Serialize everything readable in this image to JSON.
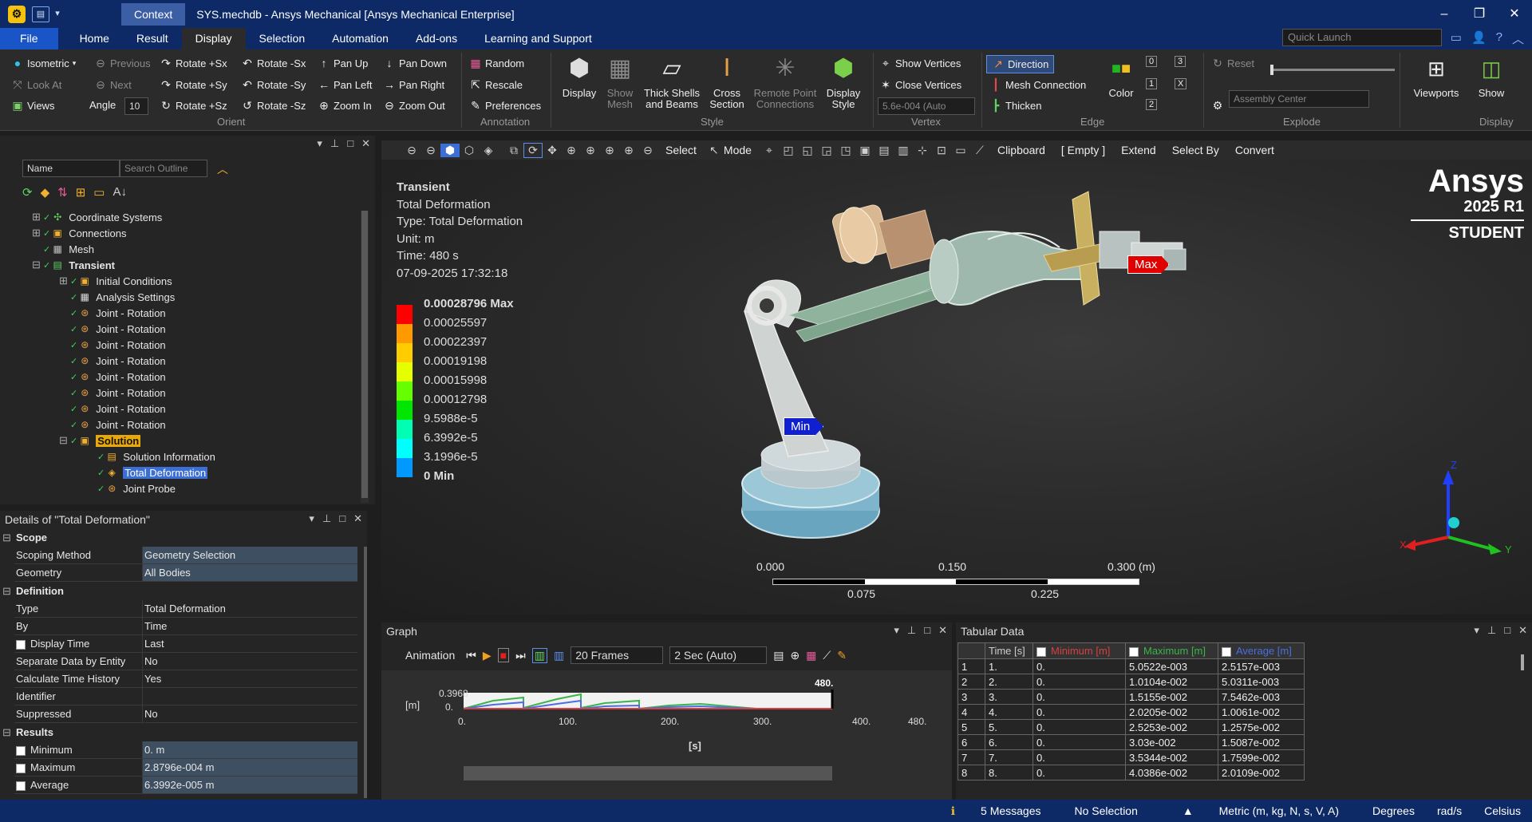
{
  "window": {
    "context_tab": "Context",
    "title": "SYS.mechdb - Ansys Mechanical [Ansys Mechanical Enterprise]"
  },
  "menu": {
    "tabs": [
      "File",
      "Home",
      "Result",
      "Display",
      "Selection",
      "Automation",
      "Add-ons",
      "Learning and Support"
    ],
    "active": "Display",
    "quick_launch": "Quick Launch"
  },
  "ribbon": {
    "orient": {
      "isometric": "Isometric",
      "previous": "Previous",
      "look_at": "Look At",
      "next": "Next",
      "views": "Views",
      "angle_label": "Angle",
      "angle_value": "10",
      "rotate_px": "Rotate +Sx",
      "rotate_mx": "Rotate -Sx",
      "rotate_py": "Rotate +Sy",
      "rotate_my": "Rotate -Sy",
      "rotate_pz": "Rotate +Sz",
      "rotate_mz": "Rotate -Sz",
      "pan_up": "Pan Up",
      "pan_down": "Pan Down",
      "pan_left": "Pan Left",
      "pan_right": "Pan Right",
      "zoom_in": "Zoom In",
      "zoom_out": "Zoom Out",
      "group": "Orient"
    },
    "annotation": {
      "random": "Random",
      "rescale": "Rescale",
      "preferences": "Preferences",
      "group": "Annotation"
    },
    "style": {
      "display": "Display",
      "show_mesh": "Show\nMesh",
      "thick_shells": "Thick Shells\nand Beams",
      "cross_section": "Cross\nSection",
      "remote_point": "Remote Point\nConnections",
      "display_style": "Display\nStyle",
      "group": "Style"
    },
    "vertex": {
      "show_vertices": "Show Vertices",
      "close_vertices": "Close Vertices",
      "value": "5.6e-004 (Auto",
      "group": "Vertex"
    },
    "edge": {
      "direction": "Direction",
      "mesh_connection": "Mesh Connection",
      "thicken": "Thicken",
      "color": "Color",
      "group": "Edge",
      "nums": [
        "0",
        "3",
        "1",
        "X",
        "2"
      ]
    },
    "explode": {
      "reset": "Reset",
      "assembly_center": "Assembly Center",
      "group": "Explode"
    },
    "display": {
      "viewports": "Viewports",
      "show": "Show",
      "group": "Display"
    }
  },
  "outline": {
    "filter_label": "Name",
    "search_placeholder": "Search Outline",
    "items": [
      {
        "label": "Coordinate Systems",
        "icon": "coordinate-icon"
      },
      {
        "label": "Connections",
        "icon": "connections-icon"
      },
      {
        "label": "Mesh",
        "icon": "mesh-icon"
      },
      {
        "label": "Transient",
        "icon": "transient-icon"
      },
      {
        "label": "Initial Conditions",
        "icon": "initial-conditions-icon"
      },
      {
        "label": "Analysis Settings",
        "icon": "analysis-settings-icon"
      },
      {
        "label": "Joint - Rotation",
        "icon": "joint-icon"
      },
      {
        "label": "Joint - Rotation",
        "icon": "joint-icon"
      },
      {
        "label": "Joint - Rotation",
        "icon": "joint-icon"
      },
      {
        "label": "Joint - Rotation",
        "icon": "joint-icon"
      },
      {
        "label": "Joint - Rotation",
        "icon": "joint-icon"
      },
      {
        "label": "Joint - Rotation",
        "icon": "joint-icon"
      },
      {
        "label": "Joint - Rotation",
        "icon": "joint-icon"
      },
      {
        "label": "Joint - Rotation",
        "icon": "joint-icon"
      },
      {
        "label": "Solution",
        "icon": "solution-icon"
      },
      {
        "label": "Solution Information",
        "icon": "solution-info-icon"
      },
      {
        "label": "Total Deformation",
        "icon": "deformation-icon"
      },
      {
        "label": "Joint Probe",
        "icon": "probe-icon"
      }
    ]
  },
  "details": {
    "title": "Details of \"Total Deformation\"",
    "scope": {
      "header": "Scope",
      "method_k": "Scoping Method",
      "method_v": "Geometry Selection",
      "geom_k": "Geometry",
      "geom_v": "All Bodies"
    },
    "definition": {
      "header": "Definition",
      "type_k": "Type",
      "type_v": "Total Deformation",
      "by_k": "By",
      "by_v": "Time",
      "dtime_k": "Display Time",
      "dtime_v": "Last",
      "sep_k": "Separate Data by Entity",
      "sep_v": "No",
      "calc_k": "Calculate Time History",
      "calc_v": "Yes",
      "id_k": "Identifier",
      "id_v": "",
      "sup_k": "Suppressed",
      "sup_v": "No"
    },
    "results": {
      "header": "Results",
      "min_k": "Minimum",
      "min_v": "0. m",
      "max_k": "Maximum",
      "max_v": "2.8796e-004 m",
      "avg_k": "Average",
      "avg_v": "6.3992e-005 m"
    }
  },
  "viewport": {
    "toolbar": {
      "select": "Select",
      "mode": "Mode",
      "clipboard": "Clipboard",
      "empty": "[ Empty ]",
      "extend": "Extend",
      "select_by": "Select By",
      "convert": "Convert"
    },
    "info": [
      "Transient",
      "Total Deformation",
      "Type: Total Deformation",
      "Unit: m",
      "Time: 480 s",
      "07-09-2025 17:32:18"
    ],
    "legend": [
      {
        "label": "0.00028796 Max",
        "color": "#ff0000"
      },
      {
        "label": "0.00025597",
        "color": "#ff9900"
      },
      {
        "label": "0.00022397",
        "color": "#ffcc00"
      },
      {
        "label": "0.00019198",
        "color": "#e6ff00"
      },
      {
        "label": "0.00015998",
        "color": "#66ff00"
      },
      {
        "label": "0.00012798",
        "color": "#00e600"
      },
      {
        "label": "9.5988e-5",
        "color": "#00ffb3"
      },
      {
        "label": "6.3992e-5",
        "color": "#00ffff"
      },
      {
        "label": "3.1996e-5",
        "color": "#0099ff"
      },
      {
        "label": "0 Min",
        "color": "#0000ff"
      }
    ],
    "brand": {
      "name": "Ansys",
      "version": "2025 R1",
      "edition": "STUDENT"
    },
    "max_tag": "Max",
    "min_tag": "Min",
    "scale": {
      "t0": "0.000",
      "t1": "0.150",
      "t2": "0.300 (m)",
      "t3": "0.075",
      "t4": "0.225"
    },
    "triad": {
      "z": "Z",
      "y": "Y",
      "x": "X"
    }
  },
  "graph": {
    "title": "Graph",
    "animation": "Animation",
    "frames": "20 Frames",
    "speed": "2 Sec (Auto)",
    "chart": {
      "y_max_label": "0.3968",
      "y_min_label": "0.",
      "x_ticks": [
        "0.",
        "100.",
        "200.",
        "300.",
        "400.",
        "480."
      ],
      "current_time": "480.",
      "x_unit": "[s]"
    }
  },
  "tabular": {
    "title": "Tabular Data",
    "headers": [
      "Time [s]",
      "Minimum [m]",
      "Maximum [m]",
      "Average [m]"
    ],
    "header_colors": [
      "#cccccc",
      "#d64040",
      "#3cb44b",
      "#4a6fe0"
    ],
    "rows": [
      [
        "1",
        "1.",
        "0.",
        "5.0522e-003",
        "2.5157e-003"
      ],
      [
        "2",
        "2.",
        "0.",
        "1.0104e-002",
        "5.0311e-003"
      ],
      [
        "3",
        "3.",
        "0.",
        "1.5155e-002",
        "7.5462e-003"
      ],
      [
        "4",
        "4.",
        "0.",
        "2.0205e-002",
        "1.0061e-002"
      ],
      [
        "5",
        "5.",
        "0.",
        "2.5253e-002",
        "1.2575e-002"
      ],
      [
        "6",
        "6.",
        "0.",
        "3.03e-002",
        "1.5087e-002"
      ],
      [
        "7",
        "7.",
        "0.",
        "3.5344e-002",
        "1.7599e-002"
      ],
      [
        "8",
        "8.",
        "0.",
        "4.0386e-002",
        "2.0109e-002"
      ]
    ]
  },
  "status": {
    "messages": "5 Messages",
    "selection": "No Selection",
    "units": "Metric (m, kg, N, s, V, A)",
    "angle": "Degrees",
    "rate": "rad/s",
    "temp": "Celsius"
  }
}
